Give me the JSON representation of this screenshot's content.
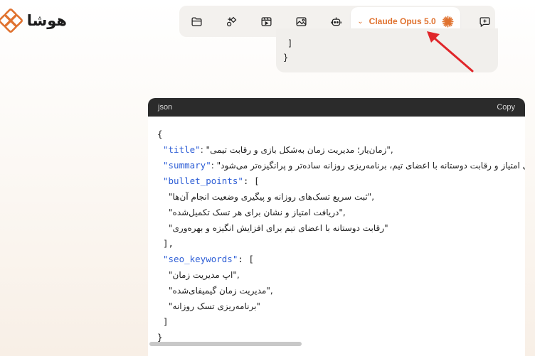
{
  "brand": {
    "name": "هوشا",
    "color": "#e0722f"
  },
  "toolbar": {
    "icons": [
      "folder-icon",
      "shapes-icon",
      "video-icon",
      "image-icon",
      "robot-icon"
    ],
    "model_label": "Claude Opus 5.0",
    "model_chevron": "⌄",
    "new_chat_icon": "chat-plus-icon"
  },
  "prev_code": {
    "lines": [
      "]",
      "}"
    ]
  },
  "code_block": {
    "language": "json",
    "copy_label": "Copy",
    "lines": [
      {
        "k": "",
        "v": "{"
      },
      {
        "k": "\"title\"",
        "v": ": \"زمان‌یار؛ مدیریت زمان به‌شکل بازی و رقابت تیمی\","
      },
      {
        "k": "\"summary\"",
        "v": ": \"جمع‌آوری امتیاز و رقابت دوستانه با اعضای تیم، برنامه‌ریزی روزانه ساده‌تر و پرانگیزه‌تر می‌شود\","
      },
      {
        "k": "\"bullet_points\"",
        "v": ": ["
      },
      {
        "k": "",
        "v": "\"ثبت سریع تسک‌های روزانه و پیگیری وضعیت انجام آن‌ها\","
      },
      {
        "k": "",
        "v": "\"دریافت امتیاز و نشان برای هر تسک تکمیل‌شده\","
      },
      {
        "k": "",
        "v": "\"رقابت دوستانه با اعضای تیم برای افزایش انگیزه و بهره‌وری\""
      },
      {
        "k": "",
        "v": "],"
      },
      {
        "k": "\"seo_keywords\"",
        "v": ": ["
      },
      {
        "k": "",
        "v": "\"اپ مدیریت زمان\","
      },
      {
        "k": "",
        "v": "\"مدیریت زمان گیمیفای‌شده\","
      },
      {
        "k": "",
        "v": "\"برنامه‌ریزی تسک روزانه\""
      },
      {
        "k": "",
        "v": "]"
      },
      {
        "k": "",
        "v": "}"
      }
    ]
  }
}
